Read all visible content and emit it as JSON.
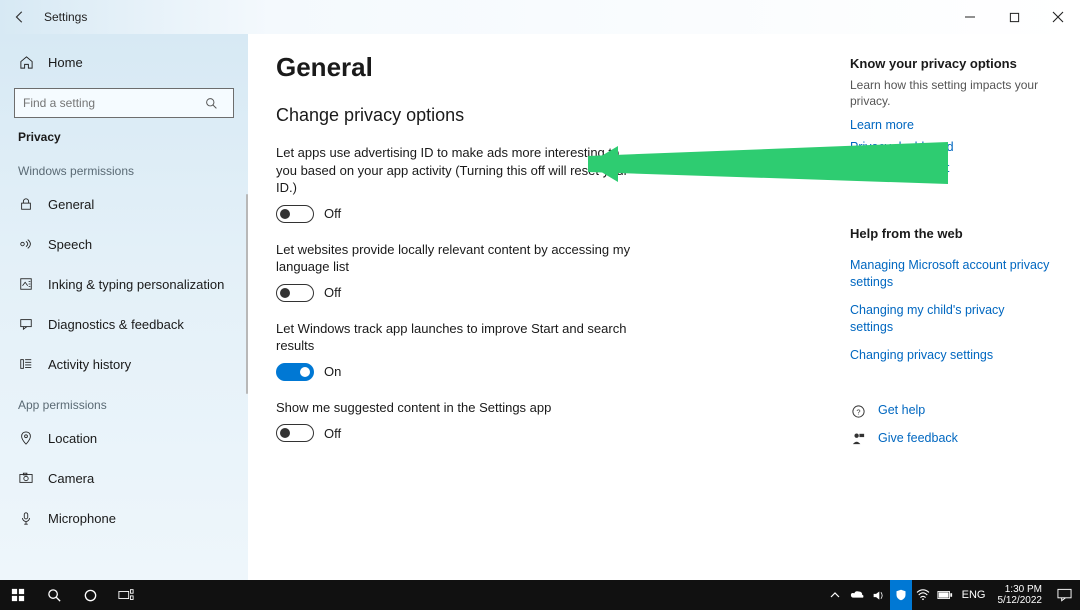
{
  "window": {
    "title": "Settings"
  },
  "sidebar": {
    "home_label": "Home",
    "search_placeholder": "Find a setting",
    "category_label": "Privacy",
    "group_windows_permissions": "Windows permissions",
    "group_app_permissions": "App permissions",
    "items_win": [
      {
        "label": "General"
      },
      {
        "label": "Speech"
      },
      {
        "label": "Inking & typing personalization"
      },
      {
        "label": "Diagnostics & feedback"
      },
      {
        "label": "Activity history"
      }
    ],
    "items_app": [
      {
        "label": "Location"
      },
      {
        "label": "Camera"
      },
      {
        "label": "Microphone"
      }
    ]
  },
  "page": {
    "title": "General",
    "section": "Change privacy options",
    "options": [
      {
        "desc": "Let apps use advertising ID to make ads more interesting to you based on your app activity (Turning this off will reset your ID.)",
        "state": "Off",
        "on": false
      },
      {
        "desc": "Let websites provide locally relevant content by accessing my language list",
        "state": "Off",
        "on": false
      },
      {
        "desc": "Let Windows track app launches to improve Start and search results",
        "state": "On",
        "on": true
      },
      {
        "desc": "Show me suggested content in the Settings app",
        "state": "Off",
        "on": false
      }
    ]
  },
  "right": {
    "hdr1": "Know your privacy options",
    "sub1": "Learn how this setting impacts your privacy.",
    "links1": [
      "Learn more",
      "Privacy dashboard",
      "Privacy statement"
    ],
    "hdr2": "Help from the web",
    "links2": [
      "Managing Microsoft account privacy settings",
      "Changing my child's privacy settings",
      "Changing privacy settings"
    ],
    "get_help": "Get help",
    "give_feedback": "Give feedback"
  },
  "taskbar": {
    "lang": "ENG",
    "time": "1:30 PM",
    "date": "5/12/2022"
  }
}
